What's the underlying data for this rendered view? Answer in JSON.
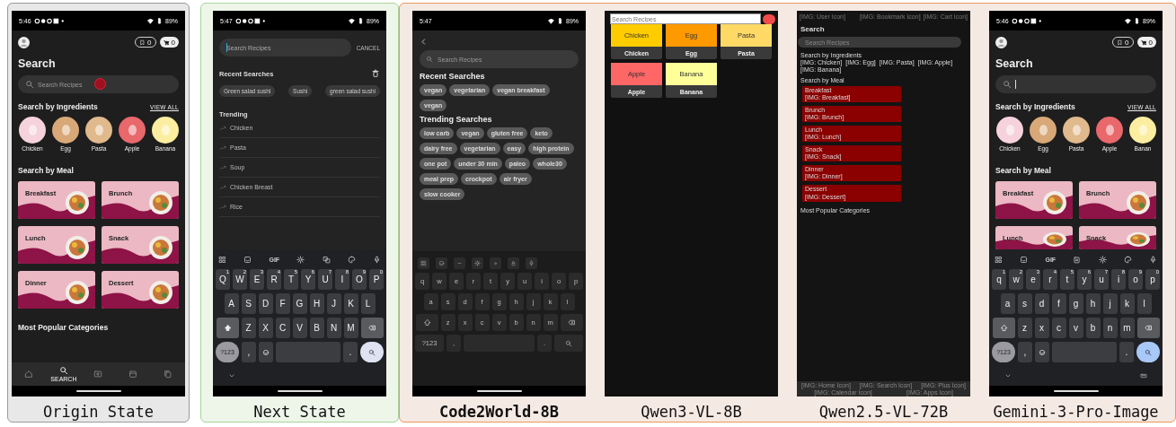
{
  "groups": [
    {
      "kind": "origin",
      "panels": [
        {
          "caption": "Origin State",
          "highlighted": false,
          "screen": {
            "kind": "home",
            "status": {
              "time": "5:46",
              "notifications": true,
              "battery": "89%"
            },
            "bookmark_count": "0",
            "cart_count": "0",
            "title": "Search",
            "search": {
              "placeholder": "Search Recipes",
              "focused": false,
              "tap_marker": true
            },
            "ingredients_title": "Search by Ingredients",
            "view_all": "VIEW ALL",
            "ingredients": [
              {
                "label": "Chicken",
                "color": "#f6d3dc"
              },
              {
                "label": "Egg",
                "color": "#d9a878"
              },
              {
                "label": "Pasta",
                "color": "#e0b98c"
              },
              {
                "label": "Apple",
                "color": "#e8686c"
              },
              {
                "label": "Banana",
                "color": "#fbeea0"
              }
            ],
            "meals_title": "Search by Meal",
            "meals": [
              "Breakfast",
              "Brunch",
              "Lunch",
              "Snack",
              "Dinner",
              "Dessert"
            ],
            "popular_title": "Most Popular Categories",
            "nav": [
              {
                "kind": "home",
                "selected": false
              },
              {
                "kind": "search",
                "label": "SEARCH",
                "selected": true
              },
              {
                "kind": "plus",
                "selected": false
              },
              {
                "kind": "calendar",
                "selected": false
              },
              {
                "kind": "collection",
                "selected": false
              }
            ]
          }
        }
      ]
    },
    {
      "kind": "target",
      "panels": [
        {
          "caption": "Next State",
          "highlighted": false,
          "screen": {
            "kind": "search",
            "status": {
              "time": "5:47",
              "notifications": true,
              "battery": "89%"
            },
            "search": {
              "placeholder": "Search Recipes",
              "focused": true
            },
            "cancel": "CANCEL",
            "recent_title": "Recent Searches",
            "recent": [
              "Green salad sushi",
              "Sushi",
              "green salad sushi"
            ],
            "trending_title": "Trending",
            "trending": [
              "Chicken",
              "Pasta",
              "Soup",
              "Chicken Breast",
              "Rice"
            ],
            "keyboard": {
              "kind": "gboard",
              "shift_on": true,
              "switcher": false,
              "toolbar": [
                {
                  "kind": "grid"
                },
                {
                  "kind": "sticker"
                },
                {
                  "kind": "text",
                  "label": "GIF"
                },
                {
                  "kind": "gear"
                },
                {
                  "kind": "translate"
                },
                {
                  "kind": "palette"
                },
                {
                  "kind": "mic"
                }
              ],
              "letters": [
                [
                  "Q",
                  "W",
                  "E",
                  "R",
                  "T",
                  "Y",
                  "U",
                  "I",
                  "O",
                  "P"
                ],
                [
                  "A",
                  "S",
                  "D",
                  "F",
                  "G",
                  "H",
                  "J",
                  "K",
                  "L"
                ],
                [
                  "Z",
                  "X",
                  "C",
                  "V",
                  "B",
                  "N",
                  "M"
                ]
              ],
              "hints": [
                "1",
                "2",
                "3",
                "4",
                "5",
                "6",
                "7",
                "8",
                "9",
                "0"
              ],
              "symbols": "?123",
              "comma": ",",
              "period": "."
            }
          }
        }
      ]
    },
    {
      "kind": "model",
      "panels": [
        {
          "caption": "Code2World-8B",
          "highlighted": true,
          "screen": {
            "kind": "chips",
            "status": {
              "time": "5:47",
              "notifications": false,
              "battery": "89%"
            },
            "search": {
              "placeholder": "Search Recipes"
            },
            "sections": [
              {
                "title": "Recent Searches",
                "chips": [
                  "vegan",
                  "vegetarian",
                  "vegan breakfast",
                  "vegan"
                ]
              },
              {
                "title": "Trending Searches",
                "chips": [
                  "low carb",
                  "vegan",
                  "gluten free",
                  "keto",
                  "dairy free",
                  "vegetarian",
                  "easy",
                  "high protein",
                  "one pot",
                  "under 30 min",
                  "paleo",
                  "whole30",
                  "meal prep",
                  "crockpot",
                  "air fryer",
                  "slow cooker"
                ]
              }
            ],
            "keyboard": {
              "kind": "flat",
              "shift_on": false,
              "switcher": false,
              "toolbar": [
                {
                  "kind": "grid"
                },
                {
                  "kind": "emoji"
                },
                {
                  "kind": "minus"
                },
                {
                  "kind": "gear"
                },
                {
                  "kind": "dot"
                },
                {
                  "kind": "lock"
                },
                {
                  "kind": "mic"
                }
              ],
              "letters": [
                [
                  "q",
                  "w",
                  "e",
                  "r",
                  "t",
                  "y",
                  "u",
                  "i",
                  "o",
                  "p"
                ],
                [
                  "a",
                  "s",
                  "d",
                  "f",
                  "g",
                  "h",
                  "j",
                  "k",
                  "l"
                ],
                [
                  "z",
                  "x",
                  "c",
                  "v",
                  "b",
                  "n",
                  "m"
                ]
              ],
              "symbols": "?123",
              "comma": ",",
              "period": "."
            }
          }
        },
        {
          "caption": "Qwen3-VL-8B",
          "highlighted": false,
          "screen": {
            "kind": "grid",
            "search": {
              "placeholder": "Search Recipes"
            },
            "tiles": [
              {
                "label": "Chicken",
                "caption": "Chicken",
                "color": "#ffcc00"
              },
              {
                "label": "Egg",
                "caption": "Egg",
                "color": "#ff9900"
              },
              {
                "label": "Pasta",
                "caption": "Pasta",
                "color": "#ffd966"
              },
              {
                "label": "Apple",
                "caption": "Apple",
                "color": "#ff6666"
              },
              {
                "label": "Banana",
                "caption": "Banana",
                "color": "#ffff99"
              }
            ]
          }
        },
        {
          "caption": "Qwen2.5-VL-72B",
          "highlighted": false,
          "screen": {
            "kind": "wireframe",
            "top_left": "[IMG: User Icon]",
            "top_right": [
              "[IMG: Bookmark Icon]",
              "[IMG: Cart Icon]"
            ],
            "title": "Search",
            "search": {
              "placeholder": "Search Recipes"
            },
            "ingredients_title": "Search by Ingredients",
            "ingredients": [
              "[IMG: Chicken]",
              "[IMG: Egg]",
              "[IMG: Pasta]",
              "[IMG: Apple]",
              "[IMG: Banana]"
            ],
            "meals_title": "Search by Meal",
            "meals": [
              {
                "name": "Breakfast",
                "image": "[IMG: Breakfast]"
              },
              {
                "name": "Brunch",
                "image": "[IMG: Brunch]"
              },
              {
                "name": "Lunch",
                "image": "[IMG: Lunch]"
              },
              {
                "name": "Snack",
                "image": "[IMG: Snack]"
              },
              {
                "name": "Dinner",
                "image": "[IMG: Dinner]"
              },
              {
                "name": "Dessert",
                "image": "[IMG: Dessert]"
              }
            ],
            "popular_title": "Most Popular Categories",
            "nav": [
              "[IMG: Home Icon]",
              "[IMG: Search Icon]",
              "[IMG: Plus Icon]",
              "[IMG: Calendar Icon]",
              "[IMG: Apps Icon]"
            ]
          }
        },
        {
          "caption": "Gemini-3-Pro-Image",
          "highlighted": false,
          "screen": {
            "kind": "home",
            "status": {
              "time": "5:46",
              "notifications": true,
              "battery": "89%"
            },
            "bookmark_count": "0",
            "cart_count": "0",
            "title": "Search",
            "search": {
              "focused": true,
              "tap_marker": false
            },
            "ingredients_title": "Search by Ingredients",
            "view_all": "VIEW ALL",
            "ingredients": [
              {
                "label": "Chicken",
                "color": "#f6d3dc"
              },
              {
                "label": "Egg",
                "color": "#d9a878"
              },
              {
                "label": "Pasta",
                "color": "#e0b98c"
              },
              {
                "label": "Apple",
                "color": "#e8686c"
              },
              {
                "label": "Banan",
                "color": "#fbeea0"
              }
            ],
            "meals_title": "Search by Meal",
            "meals": [
              "Breakfast",
              "Brunch",
              "Lunch",
              "Snack"
            ],
            "keyboard": {
              "kind": "gboard",
              "shift_on": false,
              "switcher": true,
              "toolbar": [
                {
                  "kind": "grid"
                },
                {
                  "kind": "sticker"
                },
                {
                  "kind": "text",
                  "label": "GIF"
                },
                {
                  "kind": "clipboard"
                },
                {
                  "kind": "gear"
                },
                {
                  "kind": "palette"
                },
                {
                  "kind": "mic"
                }
              ],
              "letters": [
                [
                  "q",
                  "w",
                  "e",
                  "r",
                  "t",
                  "y",
                  "u",
                  "i",
                  "o",
                  "p"
                ],
                [
                  "a",
                  "s",
                  "d",
                  "f",
                  "g",
                  "h",
                  "j",
                  "k",
                  "l"
                ],
                [
                  "z",
                  "x",
                  "c",
                  "v",
                  "b",
                  "n",
                  "m"
                ]
              ],
              "hints": [
                "1",
                "2",
                "3",
                "4",
                "5",
                "6",
                "7",
                "8",
                "9",
                "0"
              ],
              "symbols": "?123",
              "comma": ",",
              "period": "."
            }
          }
        }
      ]
    }
  ]
}
